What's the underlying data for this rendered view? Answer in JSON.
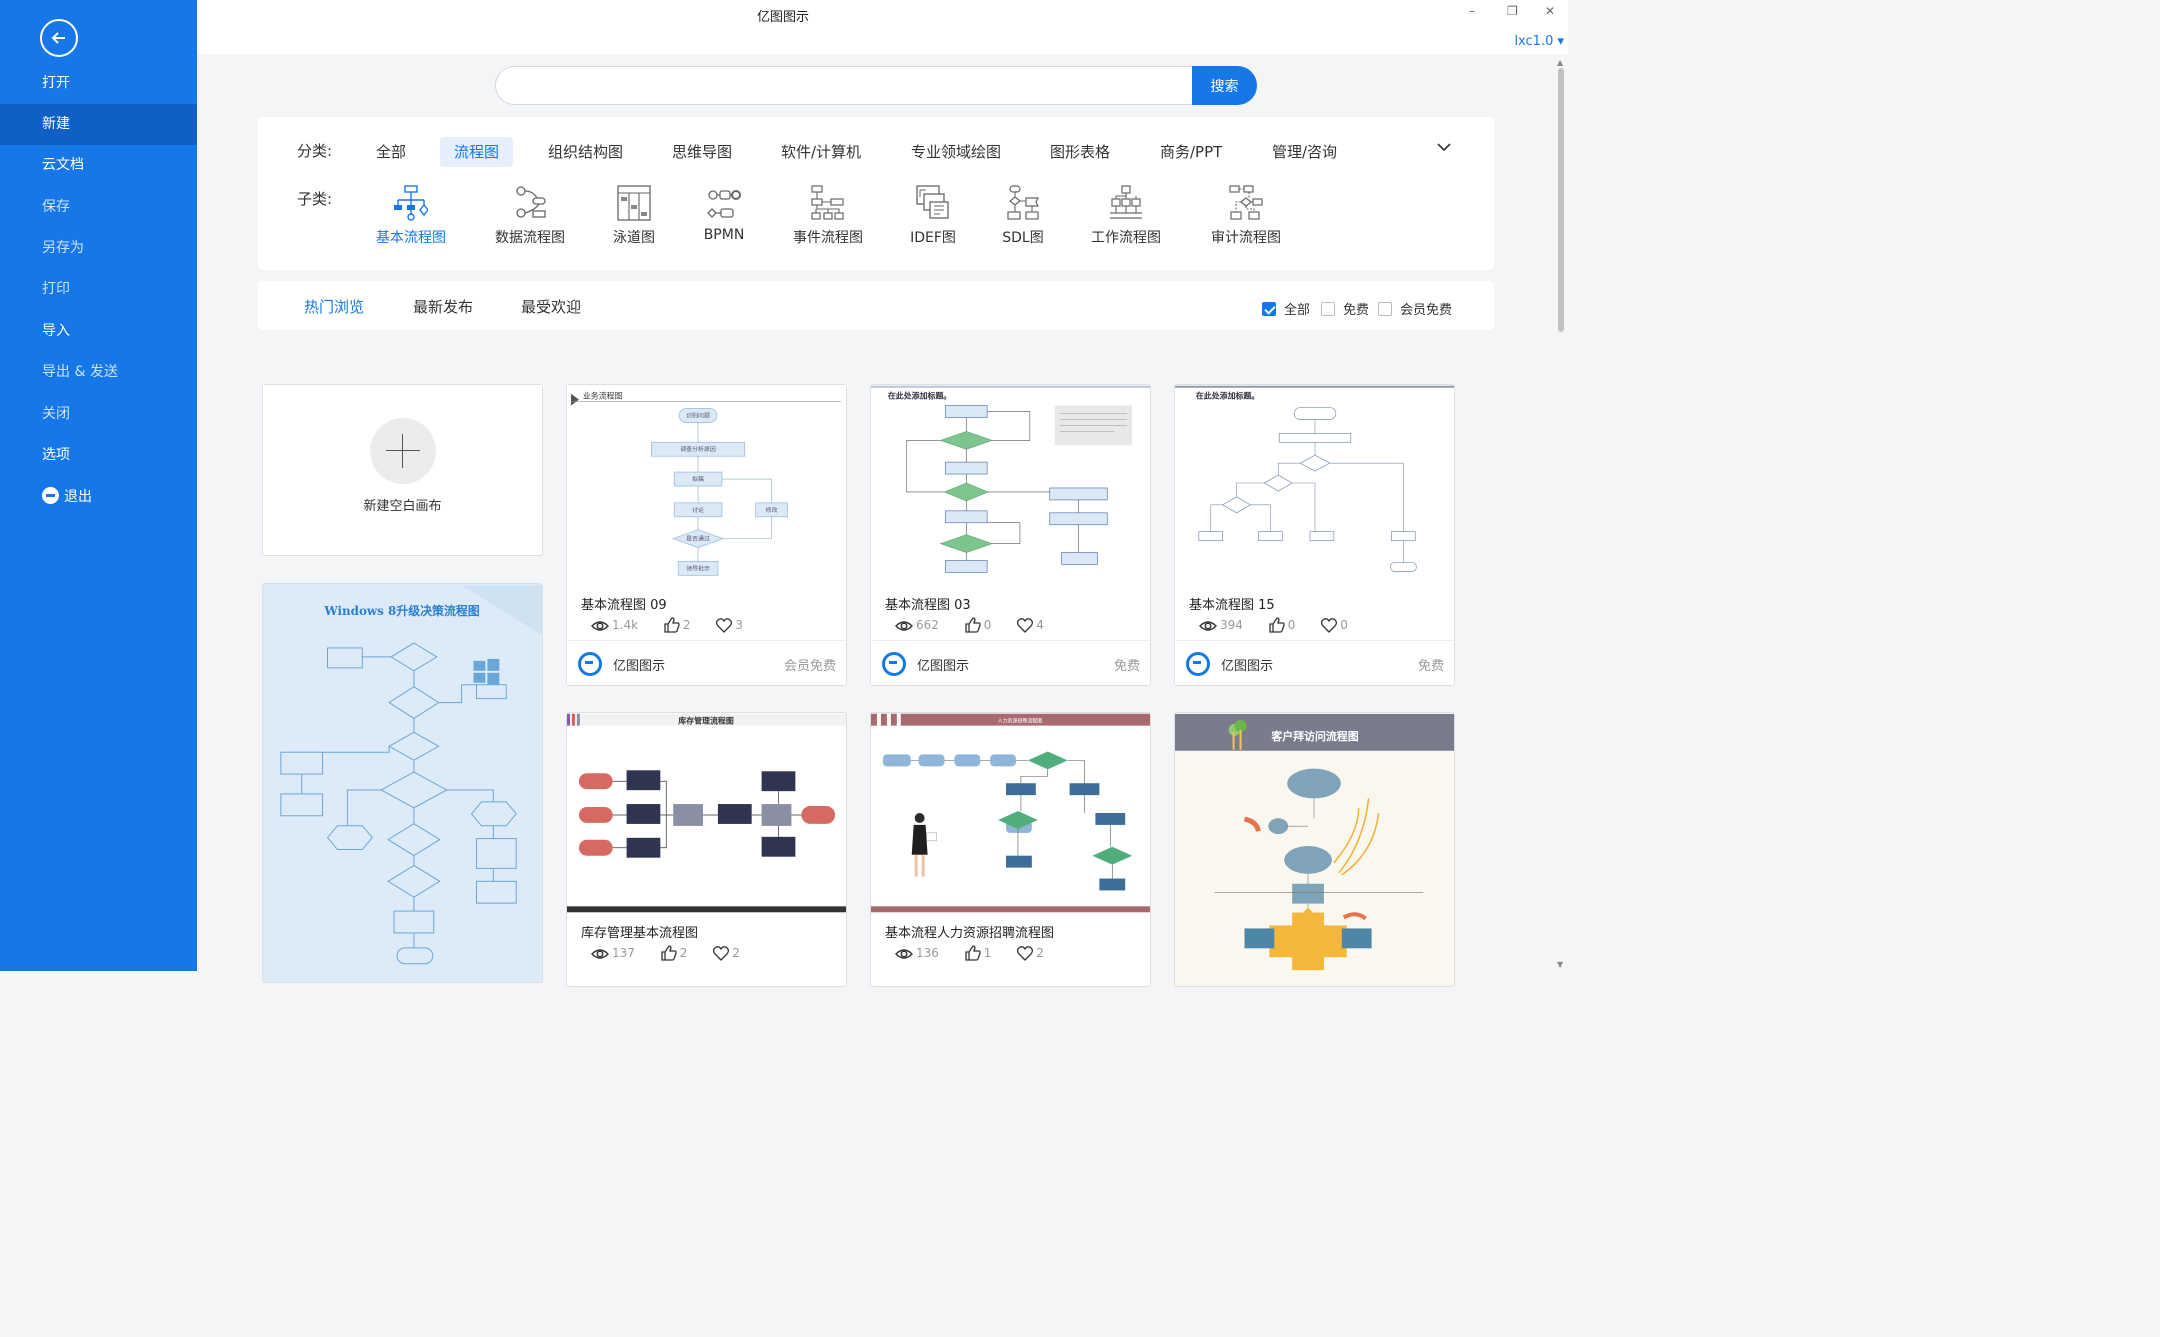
{
  "window": {
    "title": "亿图图示",
    "minimize": "–",
    "restore": "❐",
    "close": "✕"
  },
  "user_menu": "lxc1.0 ▾",
  "sidebar": {
    "items": [
      {
        "label": "打开"
      },
      {
        "label": "新建"
      },
      {
        "label": "云文档"
      },
      {
        "label": "保存"
      },
      {
        "label": "另存为"
      },
      {
        "label": "打印"
      },
      {
        "label": "导入"
      },
      {
        "label": "导出 & 发送"
      },
      {
        "label": "关闭"
      },
      {
        "label": "选项"
      },
      {
        "label": "退出"
      }
    ]
  },
  "search": {
    "placeholder": "",
    "button": "搜索"
  },
  "category": {
    "label": "分类:",
    "items": [
      "全部",
      "流程图",
      "组织结构图",
      "思维导图",
      "软件/计算机",
      "专业领域绘图",
      "图形表格",
      "商务/PPT",
      "管理/咨询"
    ],
    "active": "流程图"
  },
  "subcategory": {
    "label": "子类:",
    "items": [
      "基本流程图",
      "数据流程图",
      "泳道图",
      "BPMN",
      "事件流程图",
      "IDEF图",
      "SDL图",
      "工作流程图",
      "审计流程图"
    ],
    "active": "基本流程图"
  },
  "sort": {
    "tabs": [
      "热门浏览",
      "最新发布",
      "最受欢迎"
    ],
    "active": "热门浏览",
    "filters": [
      {
        "label": "全部",
        "checked": true
      },
      {
        "label": "免费",
        "checked": false
      },
      {
        "label": "会员免费",
        "checked": false
      }
    ]
  },
  "new_canvas": {
    "label": "新建空白画布"
  },
  "tall_template": {
    "title": "Windows 8升级决策流程图"
  },
  "templates": [
    {
      "thumb_title": "业务流程图",
      "title": "基本流程图 09",
      "views": "1.4k",
      "likes": "2",
      "favs": "3",
      "brand": "亿图图示",
      "price": "会员免费"
    },
    {
      "thumb_title": "在此处添加标题。",
      "title": "基本流程图 03",
      "views": "662",
      "likes": "0",
      "favs": "4",
      "brand": "亿图图示",
      "price": "免费"
    },
    {
      "thumb_title": "在此处添加标题。",
      "title": "基本流程图 15",
      "views": "394",
      "likes": "0",
      "favs": "0",
      "brand": "亿图图示",
      "price": "免费"
    },
    {
      "thumb_title": "库存管理流程图",
      "title": "库存管理基本流程图",
      "views": "137",
      "likes": "2",
      "favs": "2"
    },
    {
      "thumb_title": "人力资源招聘流程图",
      "title": "基本流程人力资源招聘流程图",
      "views": "136",
      "likes": "1",
      "favs": "2"
    },
    {
      "thumb_title": "客户拜访问流程图"
    }
  ],
  "colors": {
    "accent": "#1677e8",
    "sidebar_active": "#0f5fc4"
  }
}
